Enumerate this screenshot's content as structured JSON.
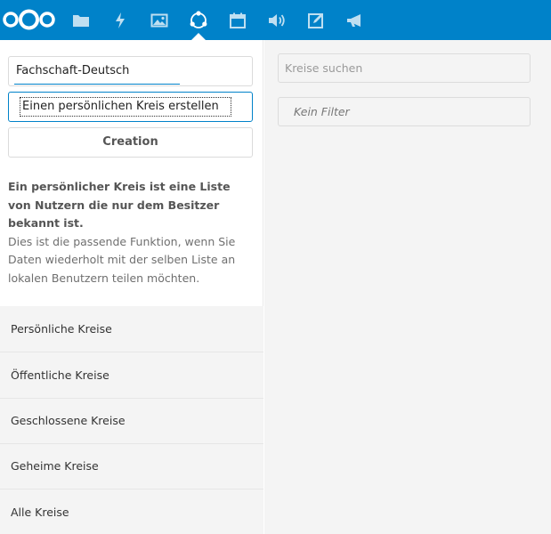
{
  "header": {
    "accent_color": "#0082c9",
    "apps": [
      {
        "name": "files",
        "icon": "folder-icon"
      },
      {
        "name": "activity",
        "icon": "lightning-icon"
      },
      {
        "name": "gallery",
        "icon": "image-icon"
      },
      {
        "name": "circles",
        "icon": "circles-icon",
        "active": true
      },
      {
        "name": "calendar",
        "icon": "calendar-icon"
      },
      {
        "name": "audio",
        "icon": "speaker-icon"
      },
      {
        "name": "notes",
        "icon": "edit-icon"
      },
      {
        "name": "announcements",
        "icon": "megaphone-icon"
      }
    ]
  },
  "sidebar": {
    "circle_name_value": "Fachschaft-Deutsch",
    "circle_type_selected": "Einen persönlichen Kreis erstellen",
    "create_button_label": "Creation",
    "description_lead": "Ein persönlicher Kreis ist eine Liste von Nutzern die nur dem Besitzer bekannt ist.",
    "description_rest": "Dies ist die passende Funktion, wenn Sie Daten wiederholt mit der selben Liste an lokalen Benutzern teilen möchten.",
    "filters": [
      "Persönliche Kreise",
      "Öffentliche Kreise",
      "Geschlossene Kreise",
      "Geheime Kreise",
      "Alle Kreise"
    ]
  },
  "main": {
    "search_placeholder": "Kreise suchen",
    "filter_label": "Kein Filter"
  }
}
